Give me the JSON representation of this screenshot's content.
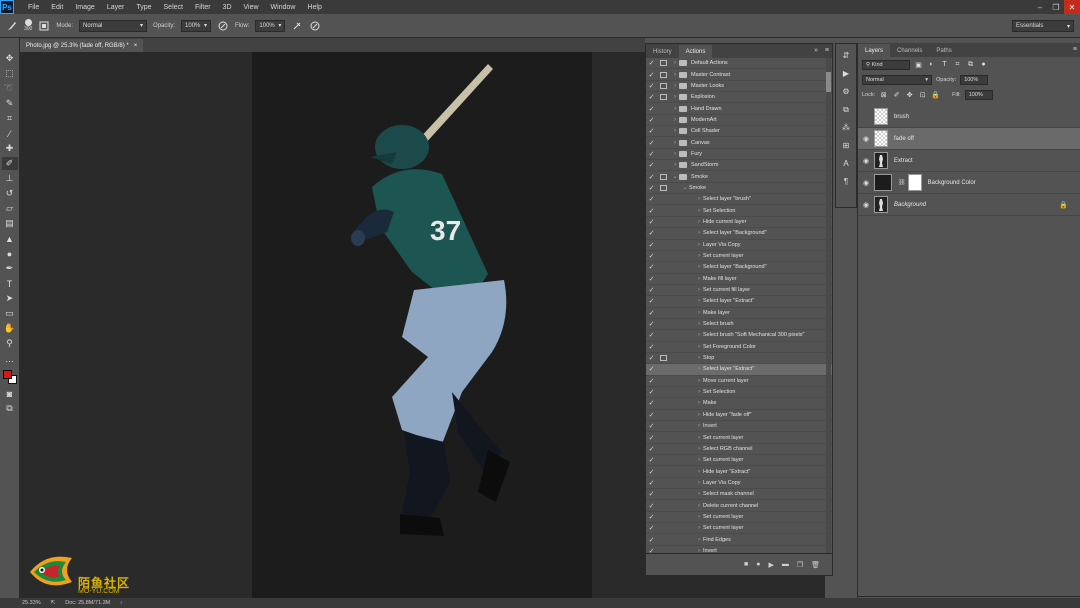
{
  "app": {
    "logo": "Ps",
    "menu": [
      "File",
      "Edit",
      "Image",
      "Layer",
      "Type",
      "Select",
      "Filter",
      "3D",
      "View",
      "Window",
      "Help"
    ],
    "window_controls": [
      "–",
      "❐",
      "✕"
    ]
  },
  "options_bar": {
    "brush_size": "300",
    "mode_label": "Mode:",
    "mode_value": "Normal",
    "opacity_label": "Opacity:",
    "opacity_value": "100%",
    "flow_label": "Flow:",
    "flow_value": "100%",
    "workspace": "Essentials"
  },
  "document": {
    "tab_title": "Photo.jpg @ 25.3% (fade off, RGB/8) *",
    "tab_close": "×"
  },
  "status": {
    "zoom": "25.33%",
    "doc_size": "Doc: 25.8M/71.3M"
  },
  "colors": {
    "foreground": "#e0121a",
    "background": "#ffffff",
    "brand_blue": "#31a8ff"
  },
  "actions_panel": {
    "tabs": [
      "History",
      "Actions"
    ],
    "active_tab": "Actions",
    "items": [
      {
        "label": "Default Actions",
        "type": "set",
        "checked": true,
        "dialog": true,
        "expanded": false
      },
      {
        "label": "Master Contrast",
        "type": "set",
        "checked": true,
        "dialog": true,
        "expanded": false
      },
      {
        "label": "Master Looks",
        "type": "set",
        "checked": true,
        "dialog": true,
        "expanded": false
      },
      {
        "label": "Explosion",
        "type": "set",
        "checked": true,
        "dialog": true,
        "expanded": false
      },
      {
        "label": "Hand Drawn",
        "type": "set",
        "checked": true,
        "dialog": false,
        "expanded": false
      },
      {
        "label": "ModernArt",
        "type": "set",
        "checked": true,
        "dialog": false,
        "expanded": false
      },
      {
        "label": "Cell Shader",
        "type": "set",
        "checked": true,
        "dialog": false,
        "expanded": false
      },
      {
        "label": "Canvas",
        "type": "set",
        "checked": true,
        "dialog": false,
        "expanded": false
      },
      {
        "label": "Fury",
        "type": "set",
        "checked": true,
        "dialog": false,
        "expanded": false
      },
      {
        "label": "SandStorm",
        "type": "set",
        "checked": true,
        "dialog": false,
        "expanded": false
      },
      {
        "label": "Smoke",
        "type": "set",
        "checked": true,
        "dialog": true,
        "expanded": true
      },
      {
        "label": "Smoke",
        "type": "action",
        "checked": true,
        "dialog": true,
        "expanded": true
      },
      {
        "label": "Select layer \"brush\"",
        "type": "step",
        "checked": true,
        "dialog": false,
        "expanded": false
      },
      {
        "label": "Set Selection",
        "type": "step",
        "checked": true,
        "dialog": false,
        "expanded": false
      },
      {
        "label": "Hide current layer",
        "type": "step",
        "checked": true,
        "dialog": false,
        "expanded": false
      },
      {
        "label": "Select layer \"Background\"",
        "type": "step",
        "checked": true,
        "dialog": false,
        "expanded": false
      },
      {
        "label": "Layer Via Copy",
        "type": "step",
        "checked": true,
        "dialog": false,
        "expanded": false
      },
      {
        "label": "Set current layer",
        "type": "step",
        "checked": true,
        "dialog": false,
        "expanded": false
      },
      {
        "label": "Select layer \"Background\"",
        "type": "step",
        "checked": true,
        "dialog": false,
        "expanded": false
      },
      {
        "label": "Make fill layer",
        "type": "step",
        "checked": true,
        "dialog": false,
        "expanded": false
      },
      {
        "label": "Set current fill layer",
        "type": "step",
        "checked": true,
        "dialog": false,
        "expanded": false
      },
      {
        "label": "Select layer \"Extract\"",
        "type": "step",
        "checked": true,
        "dialog": false,
        "expanded": false
      },
      {
        "label": "Make layer",
        "type": "step",
        "checked": true,
        "dialog": false,
        "expanded": false
      },
      {
        "label": "Select brush",
        "type": "step",
        "checked": true,
        "dialog": false,
        "expanded": false
      },
      {
        "label": "Select brush \"Soft Mechanical 300 pixels\"",
        "type": "step",
        "checked": true,
        "dialog": false,
        "expanded": false
      },
      {
        "label": "Set Foreground Color",
        "type": "step",
        "checked": true,
        "dialog": false,
        "expanded": false
      },
      {
        "label": "Stop",
        "type": "step",
        "checked": true,
        "dialog": true,
        "expanded": false
      },
      {
        "label": "Select layer \"Extract\"",
        "type": "step",
        "checked": true,
        "dialog": false,
        "expanded": false,
        "highlight": true
      },
      {
        "label": "Move current layer",
        "type": "step",
        "checked": true,
        "dialog": false,
        "expanded": false
      },
      {
        "label": "Set Selection",
        "type": "step",
        "checked": true,
        "dialog": false,
        "expanded": false
      },
      {
        "label": "Make",
        "type": "step",
        "checked": true,
        "dialog": false,
        "expanded": false
      },
      {
        "label": "Hide layer \"fade off\"",
        "type": "step",
        "checked": true,
        "dialog": false,
        "expanded": false
      },
      {
        "label": "Invert",
        "type": "step",
        "checked": true,
        "dialog": false,
        "expanded": false
      },
      {
        "label": "Set current layer",
        "type": "step",
        "checked": true,
        "dialog": false,
        "expanded": false
      },
      {
        "label": "Select RGB channel",
        "type": "step",
        "checked": true,
        "dialog": false,
        "expanded": false
      },
      {
        "label": "Set current layer",
        "type": "step",
        "checked": true,
        "dialog": false,
        "expanded": false
      },
      {
        "label": "Hide layer \"Extract\"",
        "type": "step",
        "checked": true,
        "dialog": false,
        "expanded": false
      },
      {
        "label": "Layer Via Copy",
        "type": "step",
        "checked": true,
        "dialog": false,
        "expanded": false
      },
      {
        "label": "Select mask channel",
        "type": "step",
        "checked": true,
        "dialog": false,
        "expanded": false
      },
      {
        "label": "Delete current channel",
        "type": "step",
        "checked": true,
        "dialog": false,
        "expanded": false
      },
      {
        "label": "Set current layer",
        "type": "step",
        "checked": true,
        "dialog": false,
        "expanded": false
      },
      {
        "label": "Set current layer",
        "type": "step",
        "checked": true,
        "dialog": false,
        "expanded": false
      },
      {
        "label": "Find Edges",
        "type": "step",
        "checked": true,
        "dialog": false,
        "expanded": false
      },
      {
        "label": "Invert",
        "type": "step",
        "checked": true,
        "dialog": false,
        "expanded": false
      }
    ],
    "bottom_icons": [
      "■",
      "●",
      "▶",
      "▬",
      "❐",
      "🗑"
    ]
  },
  "layers_panel": {
    "tabs": [
      "Layers",
      "Channels",
      "Paths"
    ],
    "active_tab": "Layers",
    "filter_kind": "Kind",
    "blend_mode": "Normal",
    "opacity_label": "Opacity:",
    "opacity_value": "100%",
    "lock_label": "Lock:",
    "fill_label": "Fill:",
    "fill_value": "100%",
    "layers": [
      {
        "name": "brush",
        "visible": false,
        "selected": false,
        "thumb": "transparent"
      },
      {
        "name": "fade off",
        "visible": true,
        "selected": true,
        "thumb": "transparent"
      },
      {
        "name": "Extract",
        "visible": true,
        "selected": false,
        "thumb": "figure"
      },
      {
        "name": "Background Color",
        "visible": true,
        "selected": false,
        "thumb": "fill"
      },
      {
        "name": "Background",
        "visible": true,
        "selected": false,
        "thumb": "figure",
        "locked": true
      }
    ]
  },
  "watermark": {
    "text": "陌鱼社区",
    "url": "MO-YU.COM"
  }
}
